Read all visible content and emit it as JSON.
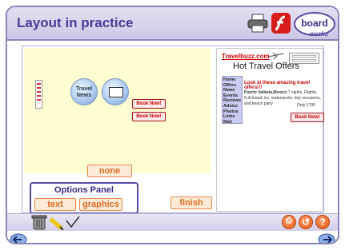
{
  "header": {
    "title": "Layout in practice",
    "logo_text": "board",
    "logo_sub": "works"
  },
  "canvas": {
    "globe_label_1": "Travel",
    "globe_label_2": "News",
    "book_now_1": "Book Now!",
    "book_now_2": "Book Now!",
    "none_label": "none"
  },
  "website": {
    "site_name": "Travelbuzz.com",
    "heading": "Hot Travel Offers",
    "nav": [
      "Home",
      "Offers",
      "News",
      "Events",
      "Reviews",
      "Advice",
      "Photos",
      "Links",
      "Mail"
    ],
    "promo": "Look at these amazing travel offers!!!",
    "description_bold": "Puerto Vallarta,Mexico",
    "description": " 7 nights, Flights, Full board, inc. watersports, day excusions, and beach party",
    "price": "Only £799",
    "book_now": "Book Now!"
  },
  "options_panel": {
    "title": "Options Panel",
    "text_button": "text",
    "graphics_button": "graphics"
  },
  "finish_label": "finish",
  "toolbar": {
    "print_label": "",
    "undo_label": "",
    "help_label": "?"
  },
  "icons": [
    "printer-icon",
    "flash-icon",
    "trash-icon",
    "pencil-icon",
    "tick-icon",
    "back-arrow-icon",
    "forward-arrow-icon",
    "undo-icon",
    "help-icon"
  ],
  "colors": {
    "accent": "#4a3a9a",
    "button_text": "#e06a20",
    "canvas_bg": "#fffdd2"
  }
}
